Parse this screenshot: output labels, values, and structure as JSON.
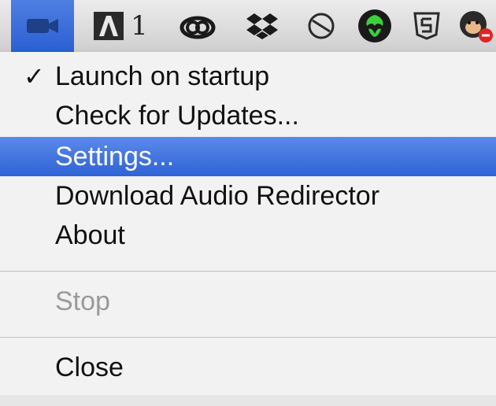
{
  "menubar": {
    "items": [
      {
        "name": "camera-app",
        "active": true
      },
      {
        "name": "adobe-notifications",
        "badge": "1"
      },
      {
        "name": "creative-cloud"
      },
      {
        "name": "dropbox"
      },
      {
        "name": "disabled-sync"
      },
      {
        "name": "razer-synapse"
      },
      {
        "name": "html5"
      },
      {
        "name": "gorilla-app"
      }
    ],
    "badge_count": "1"
  },
  "menu": {
    "items": [
      {
        "label": "Launch on startup",
        "checked": true,
        "state": "normal"
      },
      {
        "label": "Check for Updates...",
        "state": "normal"
      },
      {
        "label": "Settings...",
        "state": "highlighted"
      },
      {
        "label": "Download Audio Redirector",
        "state": "normal"
      },
      {
        "label": "About",
        "state": "normal"
      },
      {
        "label": "Stop",
        "state": "disabled"
      },
      {
        "label": "Close",
        "state": "normal"
      }
    ],
    "check_mark": "✓"
  },
  "colors": {
    "highlight": "#2f63d6",
    "razer_green": "#3ad13a",
    "disabled_text": "#9a9a9a"
  }
}
